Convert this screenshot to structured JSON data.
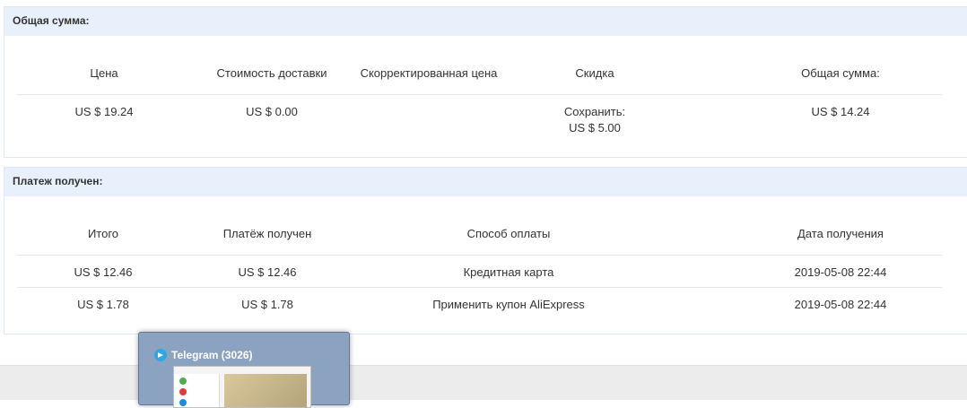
{
  "summary": {
    "title": "Общая сумма:",
    "headers": [
      "Цена",
      "Стоимость доставки",
      "Скорректированная цена",
      "Скидка",
      "Общая сумма:"
    ],
    "row": {
      "price": "US $ 19.24",
      "shipping": "US $ 0.00",
      "adjusted": "",
      "discount_line1": "Сохранить:",
      "discount_line2": "US $ 5.00",
      "total": "US $ 14.24"
    }
  },
  "payment": {
    "title": "Платеж получен:",
    "headers": [
      "Итого",
      "Платёж получен",
      "Способ оплаты",
      "Дата получения"
    ],
    "rows": [
      {
        "total": "US $ 12.46",
        "received": "US $ 12.46",
        "method": "Кредитная карта",
        "date": "2019-05-08 22:44"
      },
      {
        "total": "US $ 1.78",
        "received": "US $ 1.78",
        "method": "Применить купон AliExpress",
        "date": "2019-05-08 22:44"
      }
    ]
  },
  "taskbar_preview": {
    "title": "Telegram (3026)",
    "icon": "telegram-icon"
  }
}
